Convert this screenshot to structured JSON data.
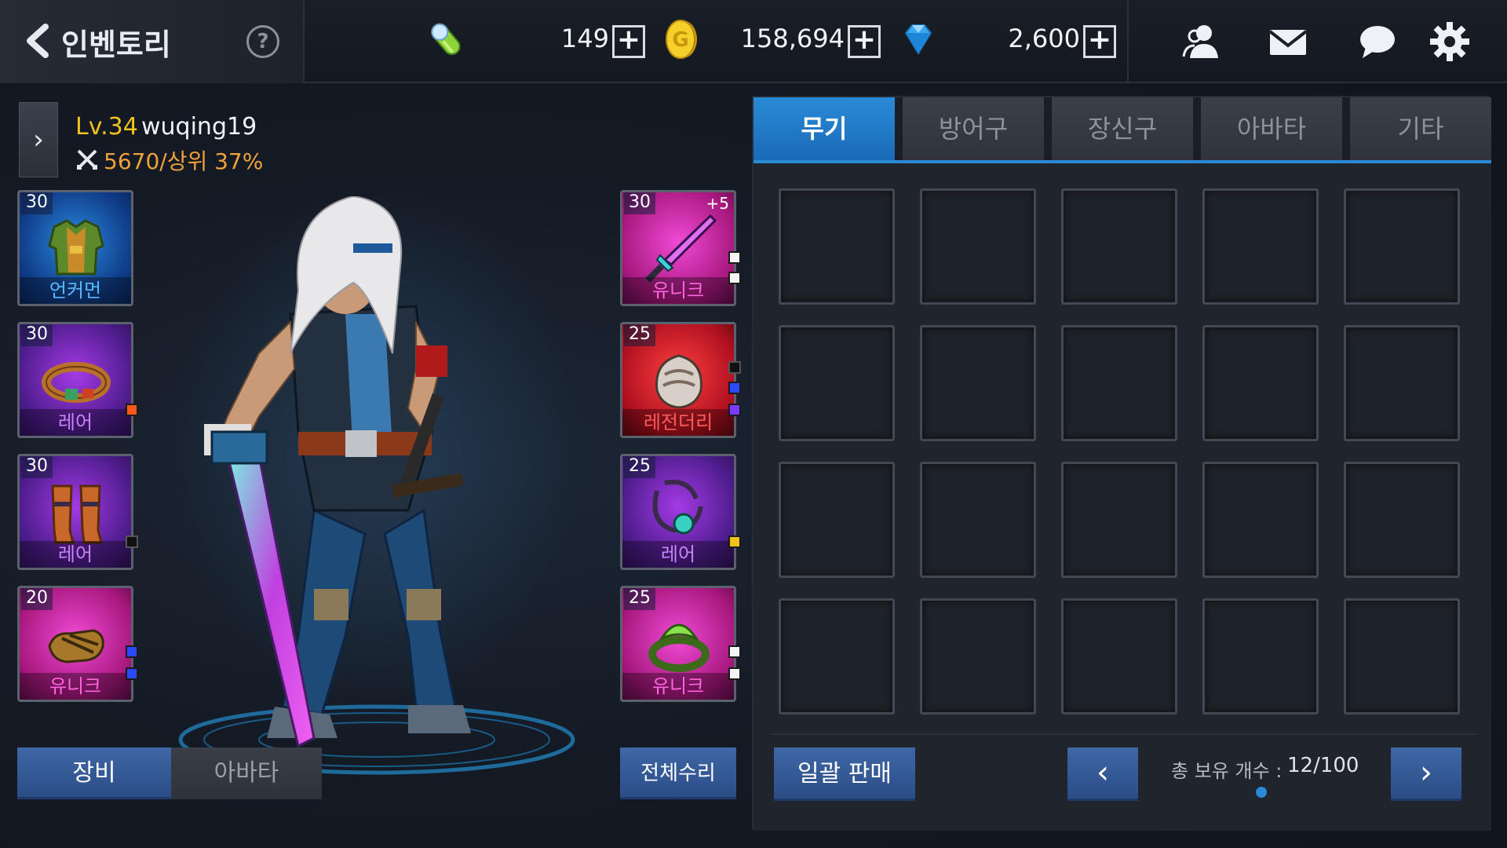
{
  "header": {
    "title": "인벤토리",
    "help": "?",
    "currencies": [
      {
        "icon": "energy-capsule-icon",
        "value": "149"
      },
      {
        "icon": "gold-coin-icon",
        "value": "158,694"
      },
      {
        "icon": "diamond-gem-icon",
        "value": "2,600"
      }
    ],
    "icons": [
      "friends-icon",
      "mail-icon",
      "chat-icon",
      "settings-gear-icon"
    ]
  },
  "character": {
    "level": "Lv.34",
    "name": "wuqing19",
    "power": "5670/상위 37%"
  },
  "equipment": {
    "left": [
      {
        "level": "30",
        "grade": "언커먼",
        "item": "armor"
      },
      {
        "level": "30",
        "grade": "레어",
        "item": "belt"
      },
      {
        "level": "30",
        "grade": "레어",
        "item": "greaves"
      },
      {
        "level": "20",
        "grade": "유니크",
        "item": "gloves"
      }
    ],
    "right": [
      {
        "level": "30",
        "grade": "유니크",
        "plus": "+5",
        "item": "sword"
      },
      {
        "level": "25",
        "grade": "레전더리",
        "item": "pauldron"
      },
      {
        "level": "25",
        "grade": "레어",
        "item": "necklace"
      },
      {
        "level": "25",
        "grade": "유니크",
        "item": "ring"
      }
    ]
  },
  "buttons": {
    "equip": "장비",
    "avatar": "아바타",
    "repair_all": "전체수리",
    "bulk_sell": "일괄 판매",
    "prev": "‹",
    "next": "›"
  },
  "inventory": {
    "tabs": [
      "무기",
      "방어구",
      "장신구",
      "아바타",
      "기타"
    ],
    "active_tab": "무기",
    "count_label": "총 보유 개수 :",
    "count_value": "12/100"
  },
  "colors": {
    "accent": "#2a8ad6",
    "button": "#3f67a6",
    "level_gold": "#f0c21a",
    "power_orange": "#f0a23a"
  }
}
